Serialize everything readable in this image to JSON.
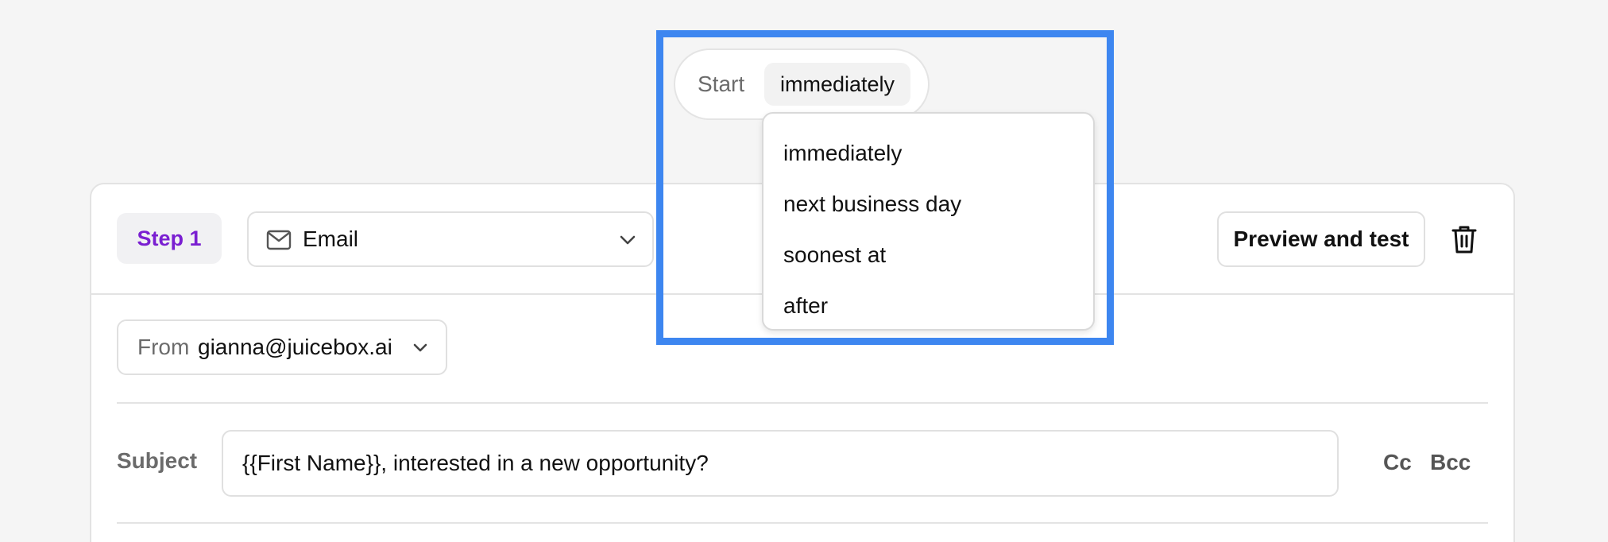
{
  "start": {
    "label": "Start",
    "selected": "immediately",
    "options": [
      "immediately",
      "next business day",
      "soonest at",
      "after"
    ]
  },
  "step": {
    "badge": "Step 1",
    "channel": "Email",
    "channel_icon": "mail-icon",
    "preview_label": "Preview and test",
    "delete_icon": "trash-icon"
  },
  "from": {
    "label": "From",
    "value": "gianna@juicebox.ai"
  },
  "subject": {
    "label": "Subject",
    "value": "{{First Name}}, interested in a new opportunity?",
    "cc_label": "Cc",
    "bcc_label": "Bcc"
  },
  "colors": {
    "accent_purple": "#7a1fd1",
    "highlight_blue": "#3d86f0",
    "background": "#f5f5f5"
  }
}
